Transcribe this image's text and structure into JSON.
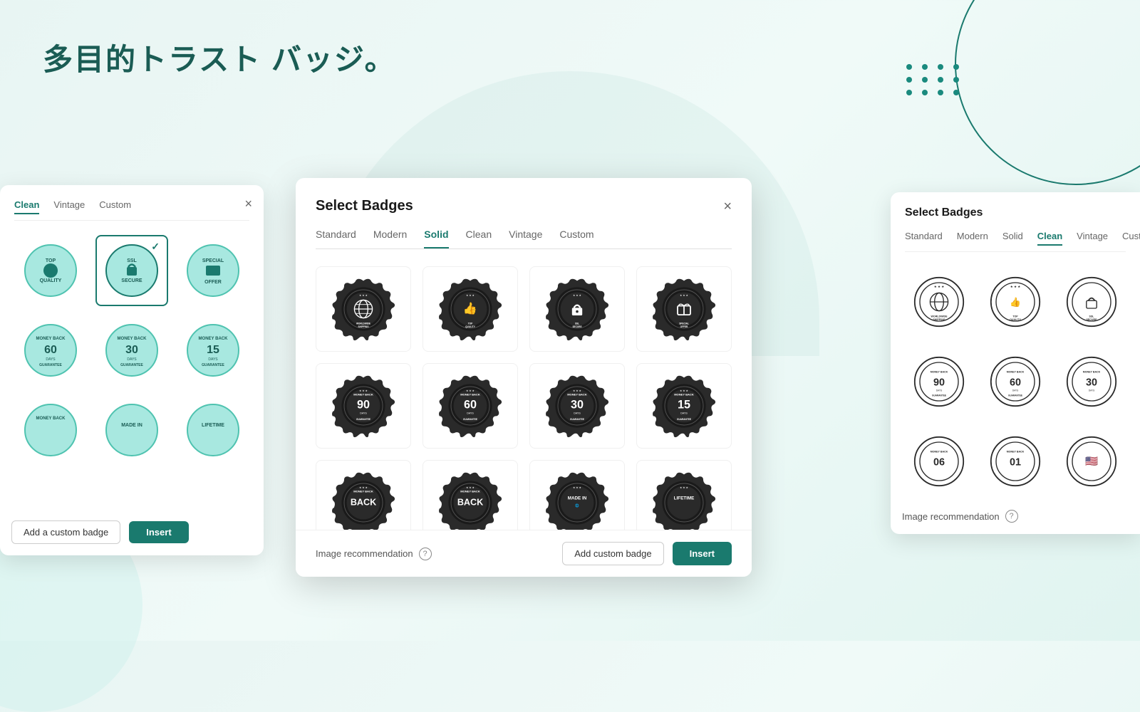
{
  "page": {
    "title": "多目的トラスト バッジ。",
    "bg_dots_count": 12
  },
  "left_panel": {
    "close_label": "×",
    "tabs": [
      {
        "id": "clean",
        "label": "Clean",
        "active": true
      },
      {
        "id": "vintage",
        "label": "Vintage",
        "active": false
      },
      {
        "id": "custom",
        "label": "Custom",
        "active": false
      }
    ],
    "add_custom_badge_label": "Add a custom badge",
    "insert_label": "Insert"
  },
  "main_dialog": {
    "title": "Select Badges",
    "close_label": "×",
    "tabs": [
      {
        "id": "standard",
        "label": "Standard",
        "active": false
      },
      {
        "id": "modern",
        "label": "Modern",
        "active": false
      },
      {
        "id": "solid",
        "label": "Solid",
        "active": true
      },
      {
        "id": "clean",
        "label": "Clean",
        "active": false
      },
      {
        "id": "vintage",
        "label": "Vintage",
        "active": false
      },
      {
        "id": "custom",
        "label": "Custom",
        "active": false
      }
    ],
    "badges": [
      {
        "id": "worldwide-shipping",
        "label": "Worldwide Shipping",
        "row": 1
      },
      {
        "id": "top-quality",
        "label": "Top Quality",
        "row": 1
      },
      {
        "id": "ssl-secure",
        "label": "SSL Secure",
        "row": 1
      },
      {
        "id": "special-offer",
        "label": "Special Offer",
        "row": 1
      },
      {
        "id": "money-back-90",
        "label": "Money Back 90 Days",
        "row": 2
      },
      {
        "id": "money-back-60",
        "label": "Money Back 60 Days",
        "row": 2
      },
      {
        "id": "money-back-30",
        "label": "Money Back 30 Days",
        "row": 2
      },
      {
        "id": "money-back-15",
        "label": "Money Back 15 Days",
        "row": 2
      },
      {
        "id": "money-back-06",
        "label": "Money Back 06",
        "row": 3
      },
      {
        "id": "money-back-01",
        "label": "Money Back 01",
        "row": 3
      },
      {
        "id": "made-in",
        "label": "Made In",
        "row": 3
      },
      {
        "id": "lifetime",
        "label": "Lifetime",
        "row": 3
      }
    ],
    "image_recommendation_label": "Image recommendation",
    "add_custom_badge_label": "Add custom badge",
    "insert_label": "Insert"
  },
  "right_panel": {
    "title": "Select Badges",
    "tabs": [
      {
        "id": "standard",
        "label": "Standard"
      },
      {
        "id": "modern",
        "label": "Modern"
      },
      {
        "id": "solid",
        "label": "Solid"
      },
      {
        "id": "clean",
        "label": "Clean",
        "active": true
      },
      {
        "id": "vintage",
        "label": "Vintage"
      },
      {
        "id": "custom",
        "label": "Custom"
      }
    ],
    "image_recommendation_label": "Image recommendation"
  },
  "colors": {
    "primary": "#1a7a6e",
    "dark": "#2a2a2a",
    "accent_teal": "#4fc3b0"
  }
}
